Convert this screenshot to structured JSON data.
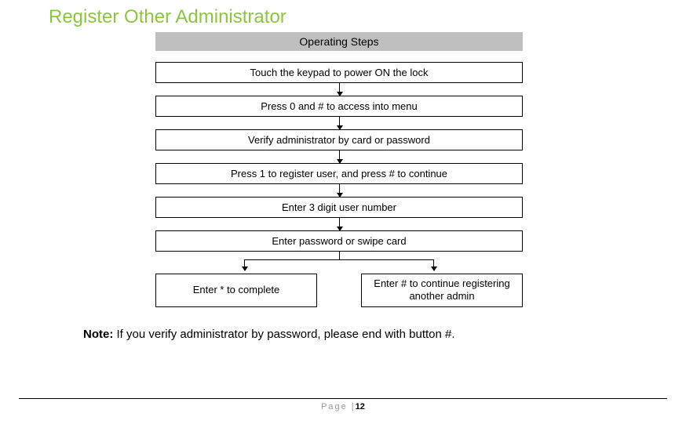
{
  "title": "Register Other Administrator",
  "header": "Operating Steps",
  "steps": [
    "Touch the keypad to power ON the lock",
    "Press  0 and  # to access into menu",
    "Verify administrator by card or password",
    "Press 1 to register user, and press # to continue",
    "Enter 3 digit user number",
    "Enter password or swipe card"
  ],
  "fork_left": "Enter * to complete",
  "fork_right": "Enter # to continue registering another admin",
  "note_label": "Note:",
  "note_text": " If you verify administrator by password, please end with button #.",
  "footer_label": "Page |",
  "footer_page": "12"
}
